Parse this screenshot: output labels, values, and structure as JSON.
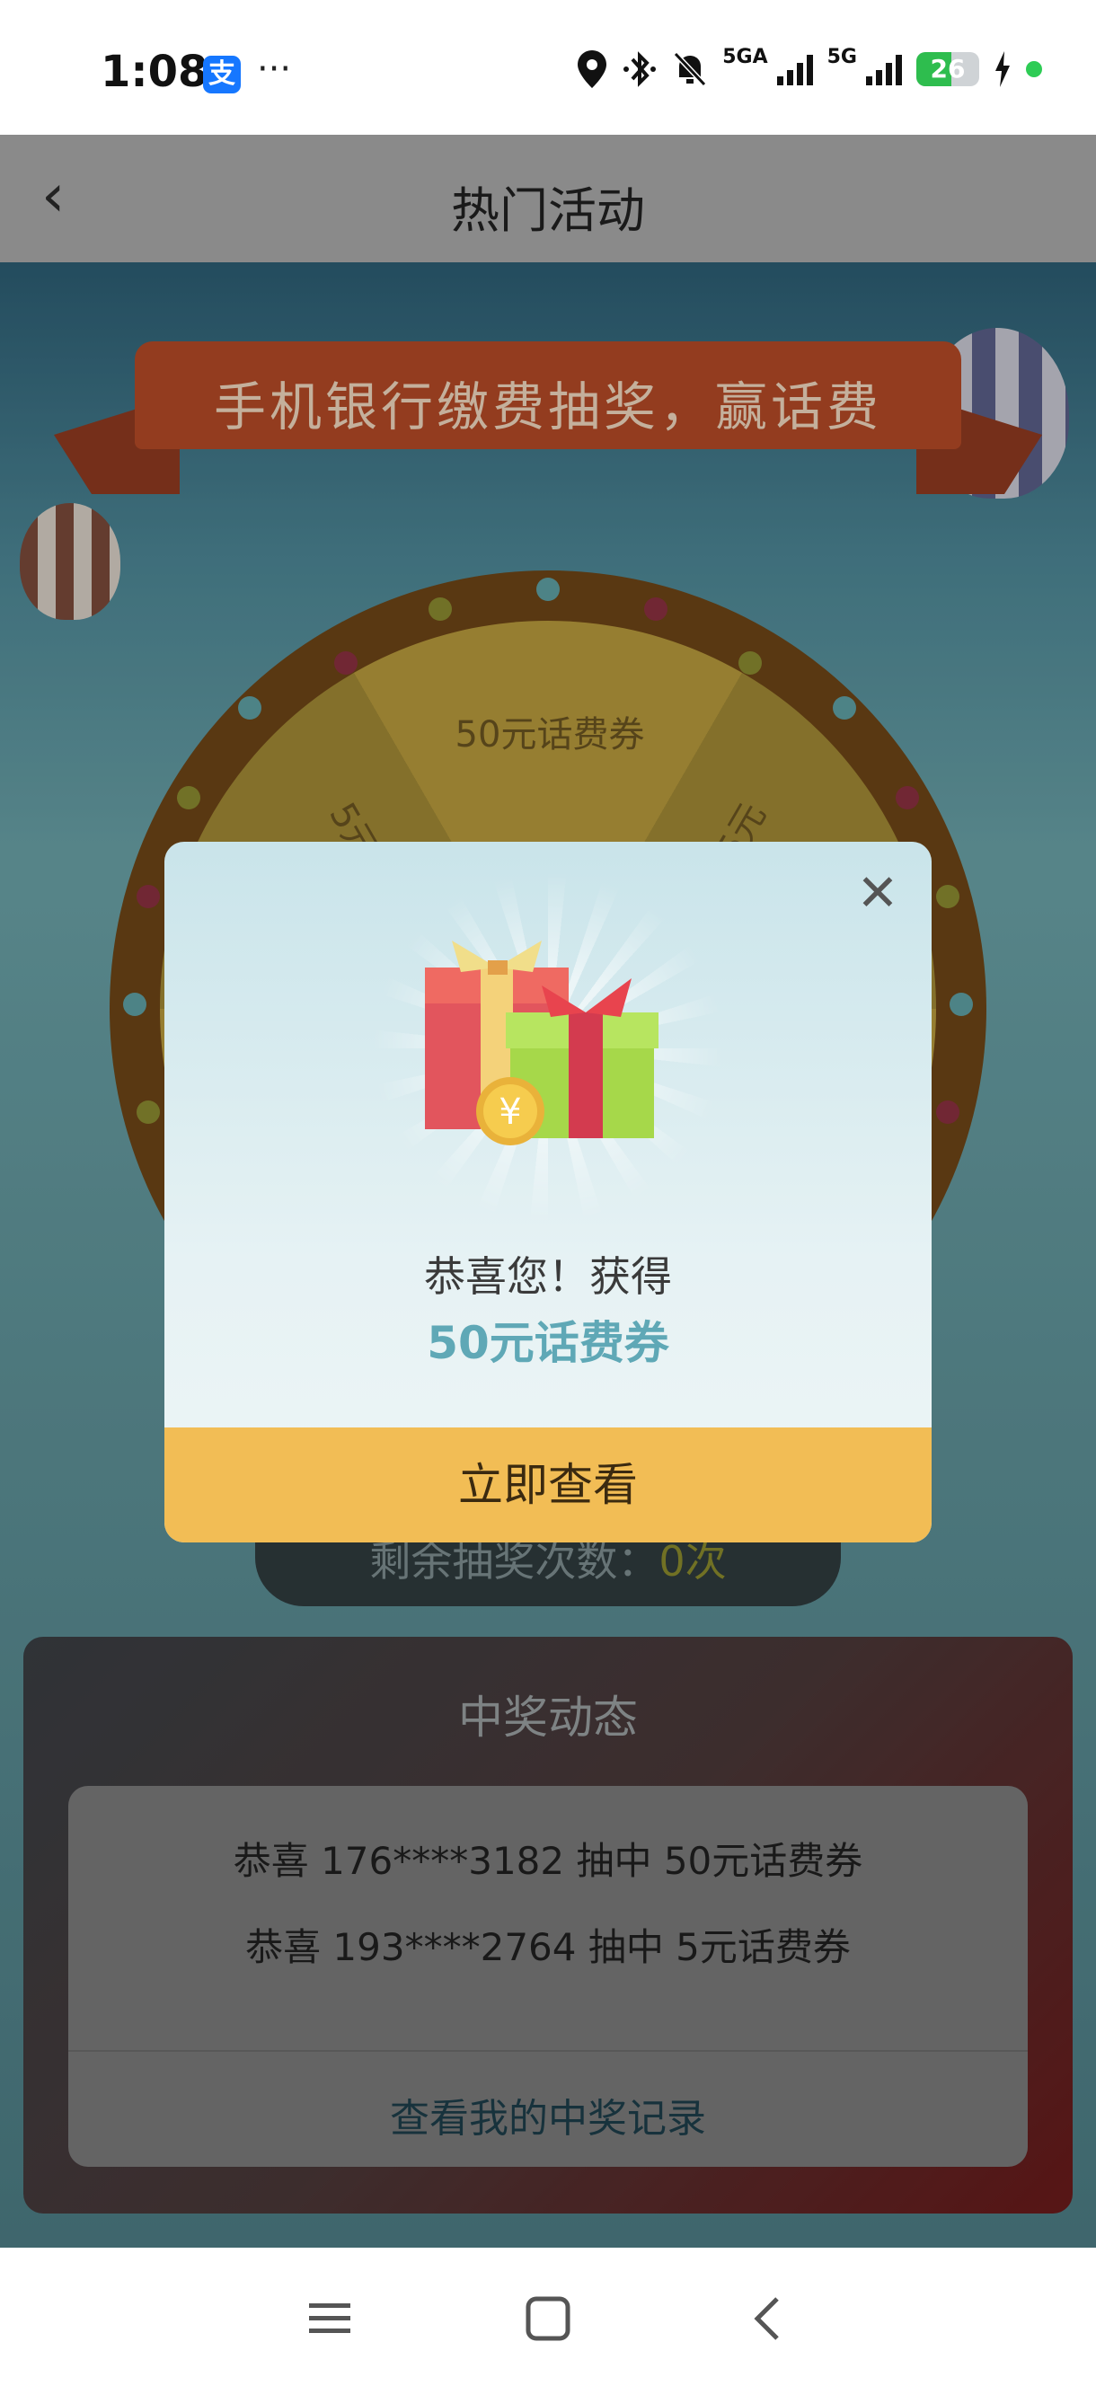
{
  "status_bar": {
    "time": "1:08",
    "alipay_glyph": "支",
    "more": "···",
    "network_1": "5GA",
    "network_2": "5G",
    "battery": "26",
    "icons": [
      "location-icon",
      "bluetooth-icon",
      "mute-icon",
      "signal-icon",
      "battery-icon",
      "charging-icon"
    ]
  },
  "header": {
    "back_icon": "‹",
    "title": "热门活动"
  },
  "banner": {
    "text": "手机银行缴费抽奖，赢话费"
  },
  "wheel": {
    "segments": [
      "50元话费券",
      "5元",
      "5元"
    ]
  },
  "remaining": {
    "label": "剩余抽奖次数：",
    "count": "0",
    "unit": "次"
  },
  "winners": {
    "title": "中奖动态",
    "rows": [
      "恭喜 176****3182 抽中 50元话费券",
      "恭喜 193****2764 抽中 5元话费券"
    ],
    "link": "查看我的中奖记录"
  },
  "modal": {
    "close": "✕",
    "message": "恭喜您！获得",
    "prize": "50元话费券",
    "button": "立即查看",
    "coin_symbol": "¥"
  },
  "colors": {
    "modal_button": "#f2bd55",
    "prize_text": "#5fa8b6",
    "overlay": "rgba(0,0,0,0.45)"
  }
}
